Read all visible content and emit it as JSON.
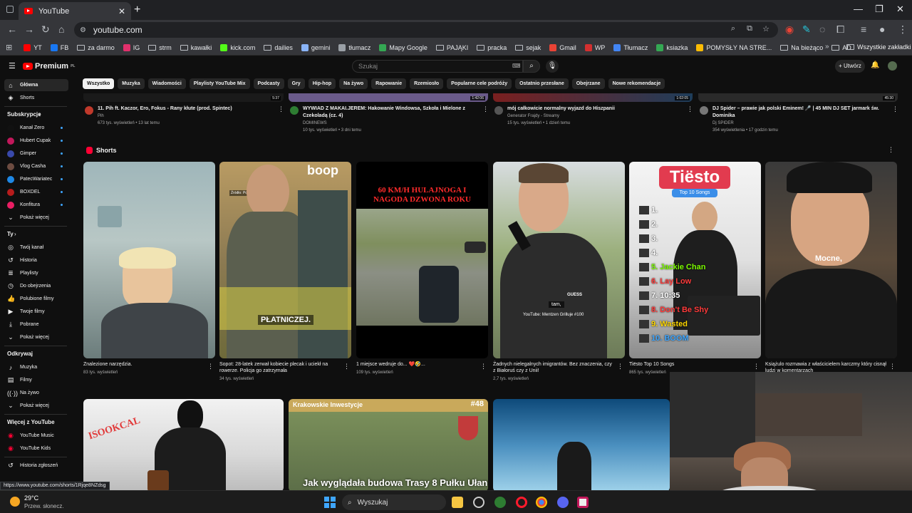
{
  "browser": {
    "tab_title": "YouTube",
    "url": "youtube.com",
    "bookmarks": [
      {
        "label": "YT",
        "color": "#ff0000"
      },
      {
        "label": "FB",
        "color": "#1877f2"
      },
      {
        "label": "za darmo",
        "color": "folder"
      },
      {
        "label": "IG",
        "color": "#e1306c"
      },
      {
        "label": "strm",
        "color": "folder"
      },
      {
        "label": "kawałki",
        "color": "folder"
      },
      {
        "label": "kick.com",
        "color": "#53fc18"
      },
      {
        "label": "dailies",
        "color": "folder"
      },
      {
        "label": "gemini",
        "color": "#8ab4f8"
      },
      {
        "label": "tłumacz",
        "color": "#9aa0a6"
      },
      {
        "label": "Mapy Google",
        "color": "#34a853"
      },
      {
        "label": "PAJĄKI",
        "color": "folder"
      },
      {
        "label": "pracka",
        "color": "folder"
      },
      {
        "label": "sejak",
        "color": "folder"
      },
      {
        "label": "Gmail",
        "color": "#ea4335"
      },
      {
        "label": "WP",
        "color": "#d32f2f"
      },
      {
        "label": "Tłumacz",
        "color": "#4285f4"
      },
      {
        "label": "ksiazka",
        "color": "#34a853"
      },
      {
        "label": "POMYSŁY NA STRE...",
        "color": "#fbbc04"
      },
      {
        "label": "Na bieżąco",
        "color": "folder"
      },
      {
        "label": "AD",
        "color": "folder"
      }
    ],
    "all_bookmarks": "Wszystkie zakładki"
  },
  "yt": {
    "logo": "Premium",
    "logo_sup": "PL",
    "search_placeholder": "Szukaj",
    "create": "+ Utwórz",
    "chips": [
      "Wszystko",
      "Muzyka",
      "Wiadomości",
      "Playlisty YouTube Mix",
      "Podcasty",
      "Gry",
      "Hip-hop",
      "Na żywo",
      "Rapowanie",
      "Rzemiosło",
      "Popularne cele podróży",
      "Ostatnio przesłane",
      "Obejrzane",
      "Nowe rekomendacje"
    ],
    "sidebar": {
      "main": [
        {
          "label": "Główna",
          "icon": "home-icon"
        },
        {
          "label": "Shorts",
          "icon": "shorts-icon"
        }
      ],
      "subs_head": "Subskrypcje",
      "subs": [
        {
          "label": "Kanał Zero",
          "color": "#111"
        },
        {
          "label": "Hubert Cupak",
          "color": "#c2185b"
        },
        {
          "label": "Gimper",
          "color": "#3949ab"
        },
        {
          "label": "Vlog Casha",
          "color": "#6d4c41"
        },
        {
          "label": "PatecWariatec",
          "color": "#1e88e5"
        },
        {
          "label": "BOXDEL",
          "color": "#b71c1c"
        },
        {
          "label": "Konfitura",
          "color": "#e91e63"
        }
      ],
      "show_more": "Pokaż więcej",
      "you_head": "Ty",
      "you": [
        {
          "label": "Twój kanał",
          "icon": "account-icon"
        },
        {
          "label": "Historia",
          "icon": "history-icon"
        },
        {
          "label": "Playlisty",
          "icon": "playlist-icon"
        },
        {
          "label": "Do obejrzenia",
          "icon": "clock-icon"
        },
        {
          "label": "Polubione filmy",
          "icon": "like-icon"
        },
        {
          "label": "Twoje filmy",
          "icon": "video-icon"
        },
        {
          "label": "Pobrane",
          "icon": "download-icon"
        },
        {
          "label": "Pokaż więcej",
          "icon": "chevron-down-icon"
        }
      ],
      "explore_head": "Odkrywaj",
      "explore": [
        {
          "label": "Muzyka",
          "icon": "music-icon"
        },
        {
          "label": "Filmy",
          "icon": "film-icon"
        },
        {
          "label": "Na żywo",
          "icon": "live-icon"
        },
        {
          "label": "Pokaż więcej",
          "icon": "chevron-down-icon"
        }
      ],
      "more_head": "Więcej z YouTube",
      "more": [
        {
          "label": "YouTube Music",
          "icon": "yt-music-icon"
        },
        {
          "label": "YouTube Kids",
          "icon": "yt-kids-icon"
        }
      ],
      "report": "Historia zgłoszeń"
    },
    "videos": [
      {
        "title": "11. Pih ft. Kaczor, Ero, Fokus - Rany kłute (prod. Spintec)",
        "channel": "Pih",
        "meta": "673 tys. wyświetleń • 13 lat temu",
        "duration": "5:37",
        "color": "#c0392b"
      },
      {
        "title": "WYWIAD Z MAKAI.JEREM: Hakowanie Windowsa, Szkoła i Mielone z Czekoladą (cz. 4)",
        "channel": "DOMINEWS",
        "meta": "10 tys. wyświetleń • 3 dni temu",
        "duration": "1:42:06",
        "color": "#2e7d32"
      },
      {
        "title": "mój całkowicie normalny wyjazd do Hiszpanii",
        "channel": "Generator Frajdy - Streamy",
        "meta": "15 tys. wyświetleń • 1 dzień temu",
        "duration": "1:02:05",
        "color": "#555"
      },
      {
        "title": "DJ Spider – prawie jak polski Eminem! 🎤 | 45 MIN DJ SET jarmark św. Dominika",
        "channel": "Dj SPIDER",
        "meta": "354 wyświetlenia • 17 godzin temu",
        "duration": "45:30",
        "color": "#777"
      }
    ],
    "shorts_head": "Shorts",
    "shorts": [
      {
        "title": "Znalezione narzędzia.",
        "meta": "83 tys. wyświetleń"
      },
      {
        "title": "Sopot: 28-latek zerwał kobiecie plecak i uciekł na rowerze. Policja go zatrzymała",
        "meta": "34 tys. wyświetleń",
        "overlay": "PŁATNICZEJ.",
        "brand": "boop",
        "source": "Źródło: Policja Pomorska"
      },
      {
        "title": "1 miejsce wedruje do... ❤️🤣...",
        "meta": "109 tys. wyświetleń",
        "overlay": "60 KM/H HULAJNOGA I NAGODA DZWONA ROKU"
      },
      {
        "title": "Żadnych nielegalnych imigrantów. Bez znaczenia, czy z Białoruś czy z Unii!",
        "meta": "2,7 tys. wyświetleń",
        "overlay": "tam,",
        "source": "YouTube: Mentzen Grilluje #100"
      },
      {
        "title": "Tiësto Top 10 Songs",
        "meta": "865 tys. wyświetleń",
        "overlay": "Tiësto",
        "sub": "Top 10 Songs",
        "list": [
          "1.",
          "2.",
          "3.",
          "4.",
          "5. Jackie Chan",
          "6. Lay Low",
          "7. 10:35",
          "8. Don't Be Shy",
          "9. Wasted",
          "10. BOOM"
        ]
      },
      {
        "title": "Książulo rozmawia z właścicielem karczmy który cisnął ludzi w komentarzach",
        "meta": "",
        "overlay": "Mocne,"
      }
    ],
    "bottom": [
      {
        "overlay": "ISOOKCAL",
        "caption": ""
      },
      {
        "header": "Krakowskie Inwestycje",
        "tag": "#48",
        "caption": "Jak wyglądała budowa Trasy 8 Pułku Ułanów"
      },
      {
        "caption": ""
      }
    ]
  },
  "status_url": "https://www.youtube.com/shorts/1Rjqe8NZdsg",
  "taskbar": {
    "temp": "29°C",
    "weather": "Przew. słonecz.",
    "search": "Wyszukaj"
  }
}
